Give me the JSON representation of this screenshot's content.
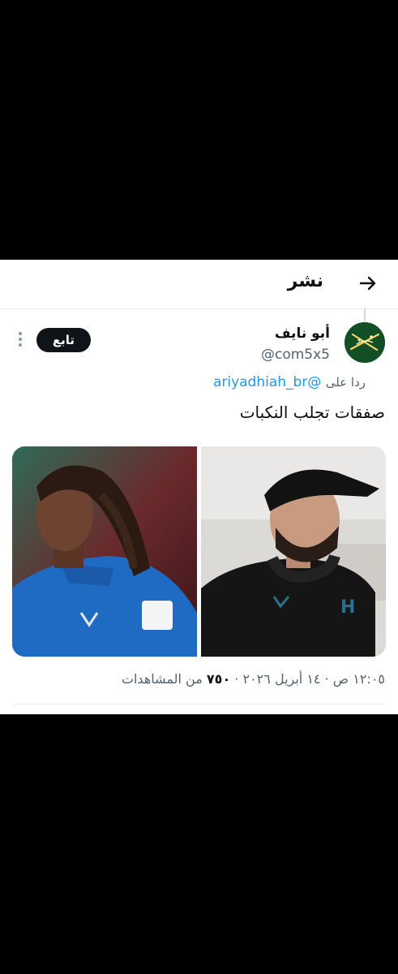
{
  "header": {
    "title": "نشر",
    "back_icon": "arrow-right-icon"
  },
  "tweet": {
    "author": {
      "display_name": "أبو نايف",
      "handle": "@com5x5",
      "avatar_icon": "crossed-swords-logo"
    },
    "follow_label": "تابع",
    "more_icon": "vertical-dots-icon",
    "reply_prefix": "ردا على",
    "reply_to": "@ariyadhiah_br",
    "text": "صفقات تجلب النكبات",
    "media": [
      {
        "name": "photo-player-black-cap",
        "colors": [
          "#d7d5d2",
          "#111111"
        ]
      },
      {
        "name": "photo-player-blue-jersey",
        "colors": [
          "#1f6bc4",
          "#5f1f26"
        ]
      }
    ],
    "time": "١٢:٠٥ ص",
    "date": "١٤ أبريل ٢٠٢٦",
    "views_count": "٧٥٠",
    "views_label": "من المشاهدات"
  },
  "colors": {
    "link": "#1d9bf0",
    "muted": "#536471",
    "button": "#0f1419"
  }
}
